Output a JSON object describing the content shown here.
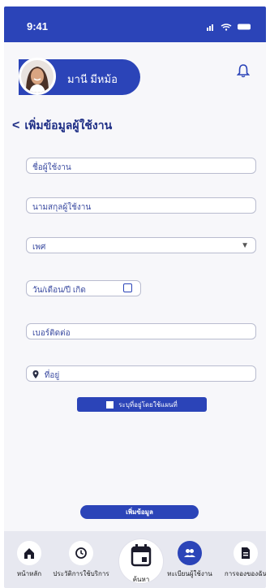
{
  "status": {
    "time": "9:41"
  },
  "profile": {
    "name": "มานี มีหม้อ"
  },
  "page": {
    "title": "เพิ่มข้อมูลผู้ใช้งาน"
  },
  "form": {
    "first_name": "ชื่อผู้ใช้งาน",
    "last_name": "นามสกุลผู้ใช้งาน",
    "gender": "เพศ",
    "birthdate": "วัน/เดือน/ปี เกิด",
    "phone": "เบอร์ติดต่อ",
    "address": "ที่อยู่",
    "map_button": "ระบุที่อยู่โดยใช้แผนที่",
    "submit": "เพิ่มข้อมูล"
  },
  "nav": {
    "items": [
      {
        "label": "หน้าหลัก",
        "icon": "home-icon"
      },
      {
        "label": "ประวัติการใช้บริการ",
        "icon": "history-icon"
      },
      {
        "label": "ค้นหา",
        "icon": "calendar-icon"
      },
      {
        "label": "ทะเบียนผู้ใช้งาน",
        "icon": "users-icon"
      },
      {
        "label": "การจองของฉัน",
        "icon": "document-icon"
      }
    ]
  },
  "colors": {
    "primary": "#2b44b8",
    "background": "#f7f7fa",
    "nav": "#e7e8f0"
  }
}
